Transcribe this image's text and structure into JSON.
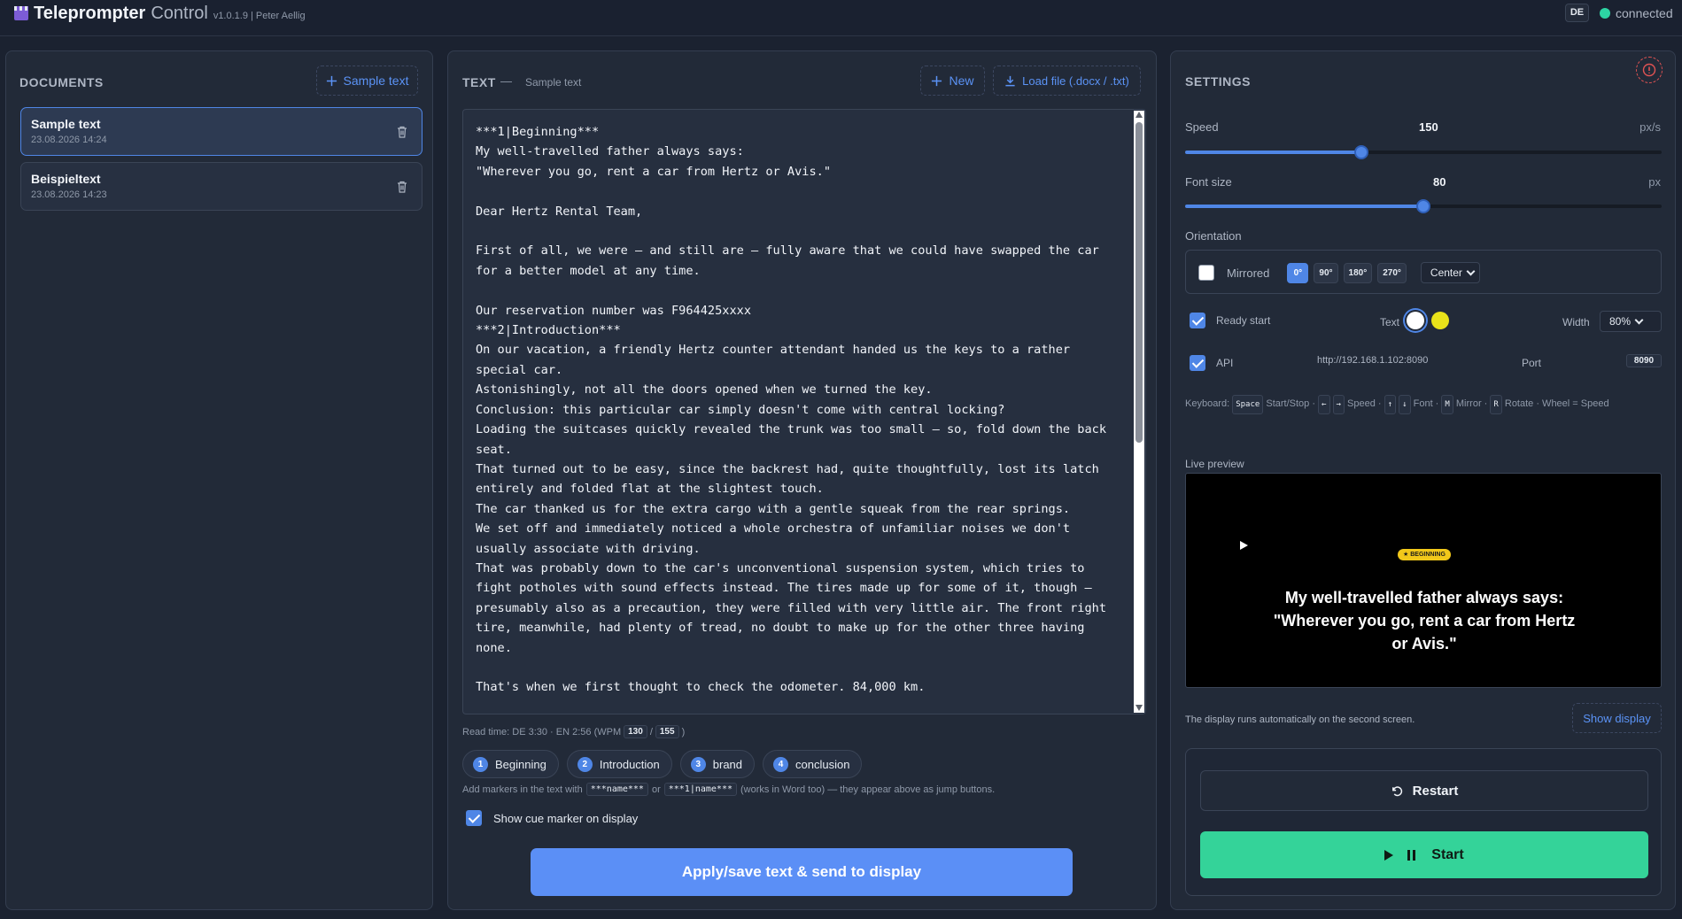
{
  "app": {
    "title": "Teleprompter",
    "subtitle": "Control",
    "version": "v1.0.1.9 | Peter Aellig",
    "language": "DE",
    "status": "connected",
    "status_color": "#2dd4a3",
    "accent": "#4f86e6",
    "start_color": "#34d399"
  },
  "documents": {
    "title": "DOCUMENTS",
    "add_button": "Sample text",
    "items": [
      {
        "name": "Sample text",
        "date": "23.08.2026 14:24",
        "active": true
      },
      {
        "name": "Beispieltext",
        "date": "23.08.2026 14:23",
        "active": false
      }
    ]
  },
  "text_panel": {
    "title": "TEXT",
    "separator": "—",
    "doc_name": "Sample text",
    "new_button": "New",
    "load_button": "Load file (.docx / .txt)",
    "content": "***1|Beginning***\nMy well-travelled father always says:\n\"Wherever you go, rent a car from Hertz or Avis.\"\n\nDear Hertz Rental Team,\n\nFirst of all, we were – and still are – fully aware that we could have swapped the car for a better model at any time.\n\nOur reservation number was F964425xxxx\n***2|Introduction***\nOn our vacation, a friendly Hertz counter attendant handed us the keys to a rather special car.\nAstonishingly, not all the doors opened when we turned the key.\nConclusion: this particular car simply doesn't come with central locking?\nLoading the suitcases quickly revealed the trunk was too small – so, fold down the back seat.\nThat turned out to be easy, since the backrest had, quite thoughtfully, lost its latch entirely and folded flat at the slightest touch.\nThe car thanked us for the extra cargo with a gentle squeak from the rear springs.\nWe set off and immediately noticed a whole orchestra of unfamiliar noises we don't usually associate with driving.\nThat was probably down to the car's unconventional suspension system, which tries to fight potholes with sound effects instead. The tires made up for some of it, though – presumably also as a precaution, they were filled with very little air. The front right tire, meanwhile, had plenty of tread, no doubt to make up for the other three having none.\n\nThat's when we first thought to check the odometer. 84,000 km.",
    "read_time": {
      "prefix": "Read time: DE 3:30 · EN 2:56 (WPM",
      "wpm_de": "130",
      "slash": "/",
      "wpm_en": "155",
      "suffix": ")"
    },
    "markers": [
      {
        "num": "1",
        "label": "Beginning"
      },
      {
        "num": "2",
        "label": "Introduction"
      },
      {
        "num": "3",
        "label": "brand"
      },
      {
        "num": "4",
        "label": "conclusion"
      }
    ],
    "hint": {
      "prefix": "Add markers in the text with",
      "code1": "***name***",
      "or": "or",
      "code2": "***1|name***",
      "suffix": "(works in Word too) — they appear above as jump buttons."
    },
    "cue_label": "Show cue marker on display",
    "cue_checked": true,
    "apply_button": "Apply/save text & send to display"
  },
  "settings": {
    "title": "SETTINGS",
    "speed": {
      "label": "Speed",
      "value": "150",
      "unit": "px/s",
      "fraction": 0.37
    },
    "font_size": {
      "label": "Font size",
      "value": "80",
      "unit": "px",
      "fraction": 0.5
    },
    "orientation": {
      "label": "Orientation",
      "mirrored_label": "Mirrored",
      "mirrored_checked": false,
      "rotations": [
        "0°",
        "90°",
        "180°",
        "270°"
      ],
      "active_rotation": "0°",
      "align": "Center"
    },
    "ready_start": {
      "label": "Ready start",
      "checked": true
    },
    "text_color": {
      "label": "Text",
      "options": [
        "#ffffff",
        "#e8e21a"
      ],
      "selected": "#ffffff"
    },
    "width": {
      "label": "Width",
      "value": "80%"
    },
    "api": {
      "label": "API",
      "checked": true,
      "url": "http://192.168.1.102:8090",
      "port_label": "Port",
      "port": "8090"
    },
    "keyboard": {
      "label": "Keyboard:",
      "space": "Space",
      "start_stop": "Start/Stop ·",
      "left": "←",
      "right": "→",
      "speed": "Speed ·",
      "up": "↑",
      "down": "↓",
      "font": "Font ·",
      "m": "M",
      "mirror": "Mirror ·",
      "r": "R",
      "rotate": "Rotate · Wheel =",
      "wheel_speed": "Speed"
    },
    "live_preview": {
      "label": "Live preview",
      "badge": "★ BEGINNING",
      "text": "My well-travelled father always says:\n\"Wherever you go, rent a car from Hertz or Avis.\""
    },
    "display_note": "The display runs automatically on the second screen.",
    "show_display_button": "Show display",
    "restart_button": "Restart",
    "start_button": "Start"
  }
}
